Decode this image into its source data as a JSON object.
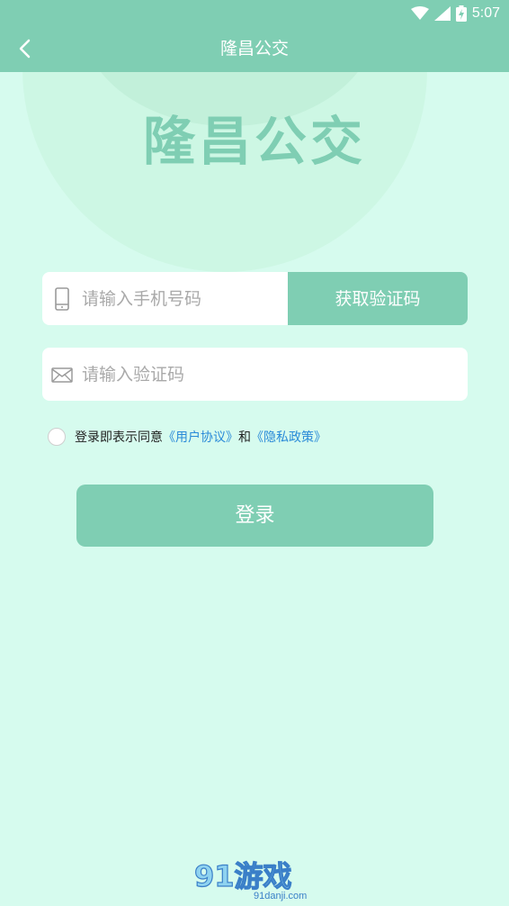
{
  "status_bar": {
    "time": "5:07",
    "icons": [
      "wifi-icon",
      "signal-icon",
      "battery-charging-icon"
    ]
  },
  "nav": {
    "title": "隆昌公交",
    "back_icon": "chevron-left-icon"
  },
  "hero": {
    "title": "隆昌公交"
  },
  "form": {
    "phone": {
      "icon": "phone-icon",
      "placeholder": "请输入手机号码",
      "value": ""
    },
    "get_code_label": "获取验证码",
    "code": {
      "icon": "mail-icon",
      "placeholder": "请输入验证码",
      "value": ""
    },
    "agreement": {
      "checked": false,
      "prefix": "登录即表示同意",
      "user_agreement": "《用户协议》",
      "conjunction": "和",
      "privacy_policy": "《隐私政策》"
    },
    "login_label": "登录"
  },
  "watermark": {
    "logo_text": "91游戏",
    "site": "91danji.com"
  },
  "colors": {
    "primary": "#7fceb3",
    "background": "#d6fbee",
    "link": "#2a8ad8"
  }
}
